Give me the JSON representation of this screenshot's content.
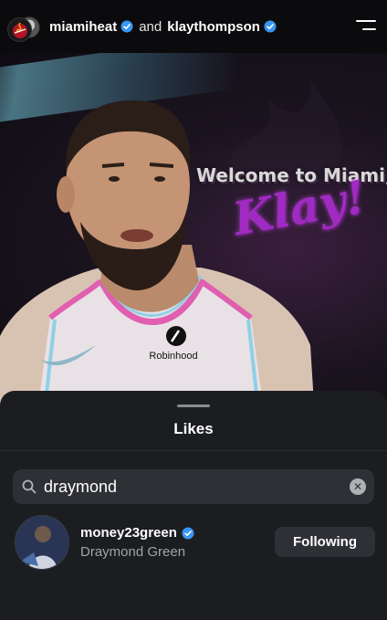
{
  "header": {
    "account1": "miamiheat",
    "joiner": "and",
    "account2": "klaythompson"
  },
  "post": {
    "headline_line1": "Welcome to Miami,",
    "headline_line2": "Klay!",
    "jersey_sponsor": "Robinhood"
  },
  "likes_sheet": {
    "title": "Likes",
    "search": {
      "value": "draymond",
      "placeholder": ""
    },
    "results": [
      {
        "username": "money23green",
        "full_name": "Draymond Green",
        "verified": true,
        "button_label": "Following"
      }
    ]
  },
  "colors": {
    "verified_blue": "#3897f0",
    "sheet_bg": "#1b1d21",
    "button_bg": "#2e3035",
    "headline_purple": "#a02bc2"
  }
}
